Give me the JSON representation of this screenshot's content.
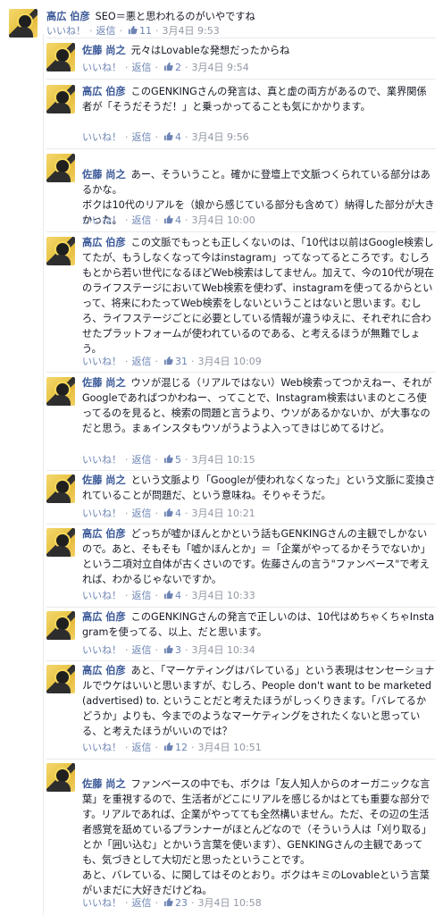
{
  "labels": {
    "like": "いいね！",
    "reply": "返信",
    "separator": "·"
  },
  "comments": [
    {
      "author": "高広 伯彦",
      "text": "SEO＝悪と思われるのがいやですね",
      "likes": "11",
      "date": "3月4日 9:53"
    },
    {
      "author": "佐藤 尚之",
      "text": "元々はLovableな発想だったからね",
      "likes": "2",
      "date": "3月4日 9:54"
    },
    {
      "author": "高広 伯彦",
      "text": "このGENKINGさんの発言は、真と虚の両方があるので、業界関係者が「そうだそうだ！」と乗っかってることも気にかかります。",
      "likes": "4",
      "date": "3月4日 9:56"
    },
    {
      "author": "佐藤 尚之",
      "text": "あー、そういうこと。確かに登壇上で文脈つくられている部分はあるかな。\nボクは10代のリアルを（娘から感じている部分も含めて）納得した部分が大きかった。",
      "likes": "4",
      "date": "3月4日 10:00"
    },
    {
      "author": "高広 伯彦",
      "text": "この文脈でもっとも正しくないのは、「10代は以前はGoogle検索してたが、もうしなくなって今はinstagram」ってなってるところです。むしろもとから若い世代になるほどWeb検索はしてません。加えて、今の10代が現在のライフステージにおいてWeb検索を使わず、instagramを使ってるからといって、将来にわたってWeb検索をしないということはないと思います。むしろ、ライフステージごとに必要としている情報が違うゆえに、それぞれに合わせたプラットフォームが使われているのである、と考えるほうが無難でしょう。",
      "likes": "31",
      "date": "3月4日 10:09"
    },
    {
      "author": "佐藤 尚之",
      "text": "ウソが混じる（リアルではない）Web検索ってつかえねー、それがGoogleであればつかわねー、ってことで、Instagram検索はいまのところ使ってるのを見ると、検索の問題と言うより、ウソがあるかないか、が大事なのだと思う。まぁインスタもウソがうようよ入ってきはじめてるけど。",
      "likes": "5",
      "date": "3月4日 10:15"
    },
    {
      "author": "佐藤 尚之",
      "text": "という文脈より「Googleが使われなくなった」という文脈に変換されていることが問題だ、という意味ね。そりゃそうだ。",
      "likes": "4",
      "date": "3月4日 10:21"
    },
    {
      "author": "高広 伯彦",
      "text": "どっちが嘘かほんとかという話もGENKINGさんの主観でしかないので。あと、そもそも「嘘かほんとか」＝「企業がやってるかそうでないか」という二項対立自体が古くさいのです。佐藤さんの言う\"ファンベース\"で考えれば、わかるじゃないですか。",
      "likes": "4",
      "date": "3月4日 10:33"
    },
    {
      "author": "高広 伯彦",
      "text": "このGENKINGさんの発言で正しいのは、10代はめちゃくちゃInstagramを使ってる、以上、だと思います。",
      "likes": "3",
      "date": "3月4日 10:34"
    },
    {
      "author": "高広 伯彦",
      "text": "あと、「マーケティングはバレている」という表現はセンセーショナルでウケはいいと思いますが、むしろ、People don't want to be marketed(advertised) to. ということだと考えたほうがしっくりきます。「バレてるかどうか」よりも、今までのようなマーケティングをされたくないと思っている、と考えたほうがいいのでは？",
      "likes": "12",
      "date": "3月4日 10:51"
    },
    {
      "author": "佐藤 尚之",
      "text": "ファンベースの中でも、ボクは「友人知人からのオーガニックな言葉」を重視するので、生活者がどこにリアルを感じるかはとても重要な部分です。リアルであれば、企業がやってても全然構いません。ただ、その辺の生活者感覚を舐めているプランナーがほとんどなので（そういう人は「刈り取る」とか「囲い込む」とかいう言葉を使います）、GENKINGさんの主観であっても、気づきとして大切だと思ったということです。\nあと、バレている、に関してはそのとおり。ボクはキミのLovableという言葉がいまだに大好きだけどね。",
      "likes": "23",
      "date": "3月4日 10:58"
    }
  ]
}
